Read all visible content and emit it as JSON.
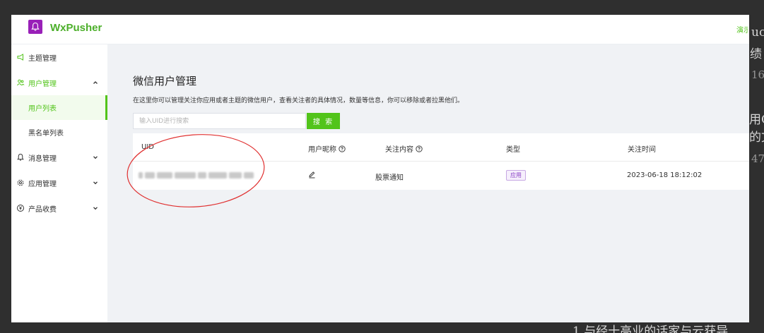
{
  "background_snippets": {
    "right_1": "uc",
    "right_2": "绩",
    "right_3": "16",
    "right_4": "用C",
    "right_5": "的文",
    "right_6": "47",
    "bottom": "1  与经十高业的话家与云获导"
  },
  "app": {
    "brand": "WxPusher",
    "top_right_link": "演示",
    "accent_color": "#52c41a",
    "logo_color": "#9920b8"
  },
  "sidebar": {
    "items": [
      {
        "label": "主题管理",
        "icon": "megaphone-icon"
      },
      {
        "label": "用户管理",
        "icon": "users-icon",
        "expanded": true
      },
      {
        "label": "消息管理",
        "icon": "bell-icon"
      },
      {
        "label": "应用管理",
        "icon": "gear-icon"
      },
      {
        "label": "产品收费",
        "icon": "yen-icon"
      }
    ],
    "sub_items": [
      {
        "label": "用户列表",
        "active": true
      },
      {
        "label": "黑名单列表",
        "active": false
      }
    ]
  },
  "main": {
    "title": "微信用户管理",
    "description": "在这里你可以管理关注你应用或者主题的微信用户，查看关注者的具体情况，数量等信息，你可以移除或者拉黑他们。",
    "search_placeholder": "输入UID进行搜索",
    "search_button": "搜 索"
  },
  "table": {
    "columns": [
      "UID",
      "用户昵称",
      "关注内容",
      "类型",
      "关注时间"
    ],
    "rows": [
      {
        "uid": "",
        "nickname_action": "edit-icon",
        "content": "股票通知",
        "type": "应用",
        "time": "2023-06-18 18:12:02"
      }
    ]
  }
}
